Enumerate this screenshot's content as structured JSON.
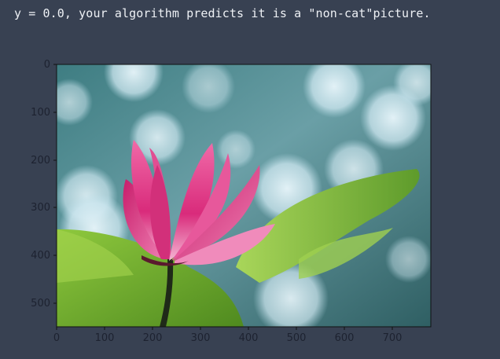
{
  "output": {
    "text": "y = 0.0, your algorithm predicts it is a \"non-cat\"picture."
  },
  "figure": {
    "image_name": "pink-lotus-flower-photo",
    "x_ticks": [
      "0",
      "100",
      "200",
      "300",
      "400",
      "500",
      "600",
      "700"
    ],
    "y_ticks": [
      "0",
      "100",
      "200",
      "300",
      "400",
      "500"
    ],
    "colors": {
      "background": "#384152",
      "lotus_pink": "#e0337f",
      "leaf_green": "#86c03a",
      "bokeh_teal": "#5a8f9a"
    }
  }
}
